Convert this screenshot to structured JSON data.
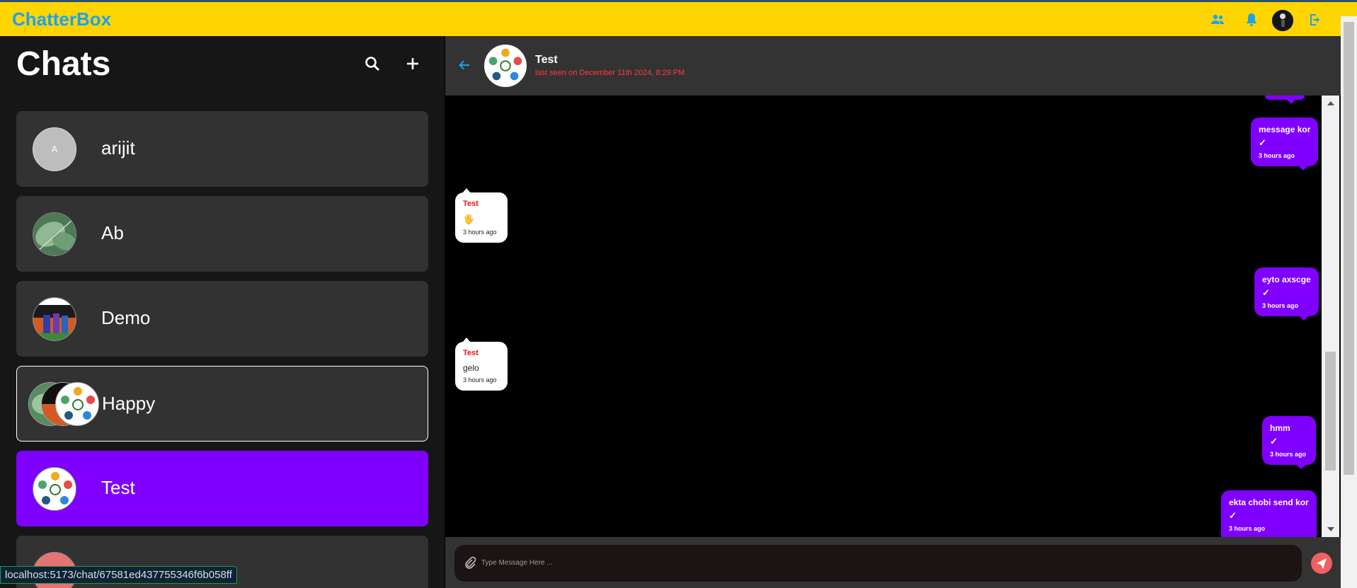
{
  "app": {
    "brand": "ChatterBox"
  },
  "colors": {
    "topbar": "#ffd500",
    "brand": "#1da1f2",
    "accent": "#8000ff",
    "sent_bubble": "#8000ff",
    "send_button": "#f06060",
    "last_seen": "#ff3b3b"
  },
  "topbar": {
    "icons": [
      "group-icon",
      "bell-icon",
      "user-avatar",
      "logout-icon"
    ]
  },
  "sidebar": {
    "title": "Chats",
    "search_icon": "search-icon",
    "add_icon": "plus-icon",
    "chats": [
      {
        "name": "arijit",
        "avatar_initial": "A",
        "active": false
      },
      {
        "name": "Ab",
        "active": false
      },
      {
        "name": "Demo",
        "active": false
      },
      {
        "name": "Happy",
        "active": false
      },
      {
        "name": "Test",
        "active": true
      }
    ]
  },
  "chat": {
    "name": "Test",
    "last_seen": "last seen on December 11th 2024, 8:29 PM",
    "messages": [
      {
        "direction": "out",
        "text": "message kor",
        "check": "✓",
        "time": "3 hours ago"
      },
      {
        "direction": "in",
        "sender": "Test",
        "text": "🖐",
        "time": "3 hours ago"
      },
      {
        "direction": "out",
        "text": "eyto axscge",
        "check": "✓",
        "time": "3 hours ago"
      },
      {
        "direction": "in",
        "sender": "Test",
        "text": "gelo",
        "time": "3 hours ago"
      },
      {
        "direction": "out",
        "text": "hmm",
        "check": "✓",
        "time": "3 hours ago"
      },
      {
        "direction": "out",
        "text": "ekta chobi send kor",
        "check": "✓",
        "time": "3 hours ago"
      }
    ],
    "input_placeholder": "Type Message Here ..."
  },
  "status_bar": {
    "url": "localhost:5173/chat/67581ed437755346f6b058ff"
  }
}
